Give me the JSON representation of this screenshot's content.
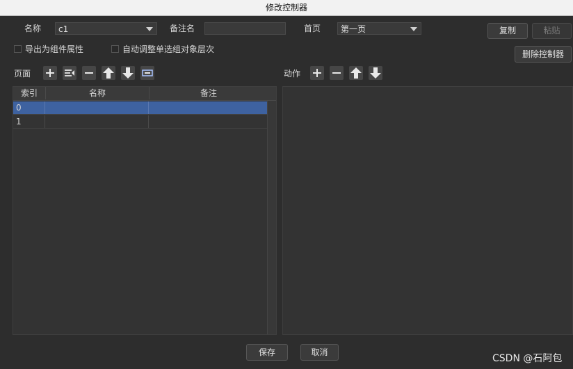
{
  "window": {
    "title": "修改控制器"
  },
  "form": {
    "name_label": "名称",
    "name_value": "c1",
    "remark_label": "备注名",
    "remark_value": "",
    "homepage_label": "首页",
    "homepage_value": "第一页",
    "copy_label": "复制",
    "paste_label": "粘贴",
    "delete_controller_label": "删除控制器",
    "export_label": "导出为组件属性",
    "auto_adjust_label": "自动调整单选组对象层次"
  },
  "pages": {
    "label": "页面",
    "toolbar_icons": [
      "add-icon",
      "insert-icon",
      "remove-icon",
      "move-up-icon",
      "move-down-icon",
      "edit-icon"
    ],
    "columns": [
      "索引",
      "名称",
      "备注"
    ],
    "rows": [
      {
        "index": "0",
        "name": "",
        "note": "",
        "selected": true
      },
      {
        "index": "1",
        "name": "",
        "note": "",
        "selected": false
      }
    ]
  },
  "actions": {
    "label": "动作",
    "toolbar_icons": [
      "add-icon",
      "remove-icon",
      "move-up-icon",
      "move-down-icon"
    ]
  },
  "footer": {
    "save_label": "保存",
    "cancel_label": "取消"
  },
  "watermark": "CSDN @石阿包",
  "colors": {
    "selection": "#3e62a0",
    "background": "#2d2d2d",
    "titlebar": "#f2f2f2"
  }
}
